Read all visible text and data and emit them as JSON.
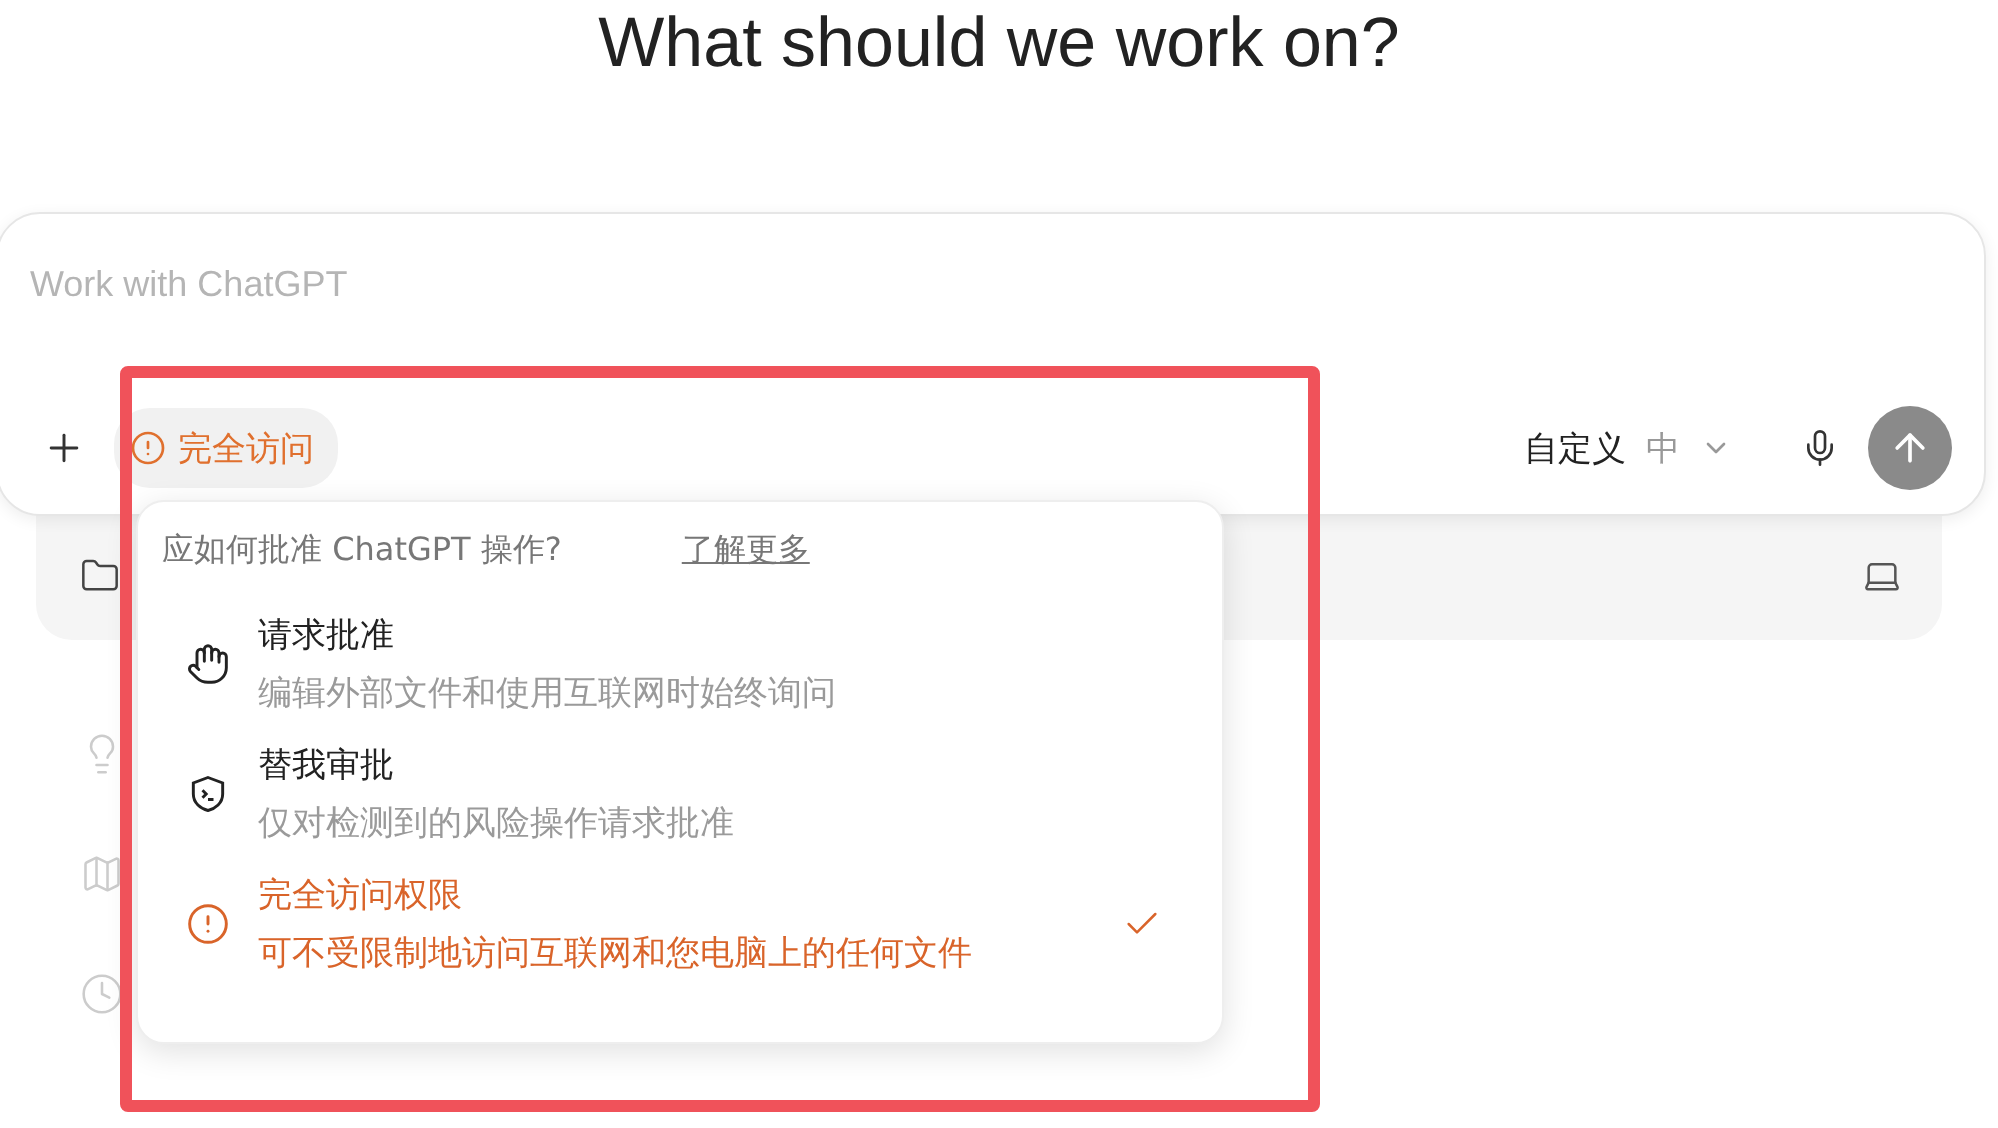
{
  "heading": "What should we work on?",
  "composer": {
    "placeholder": "Work with ChatGPT",
    "access_chip": "完全访问",
    "model": "自定义",
    "effort": "中"
  },
  "approval_menu": {
    "question": "应如何批准 ChatGPT 操作?",
    "link": "了解更多",
    "options": [
      {
        "kind": "hand",
        "title": "请求批准",
        "description": "编辑外部文件和使用互联网时始终询问",
        "selected": false
      },
      {
        "kind": "terminal",
        "title": "替我审批",
        "description": "仅对检测到的风险操作请求批准",
        "selected": false
      },
      {
        "kind": "warning",
        "title": "完全访问权限",
        "description": "可不受限制地访问互联网和您电脑上的任何文件",
        "selected": true
      }
    ]
  }
}
